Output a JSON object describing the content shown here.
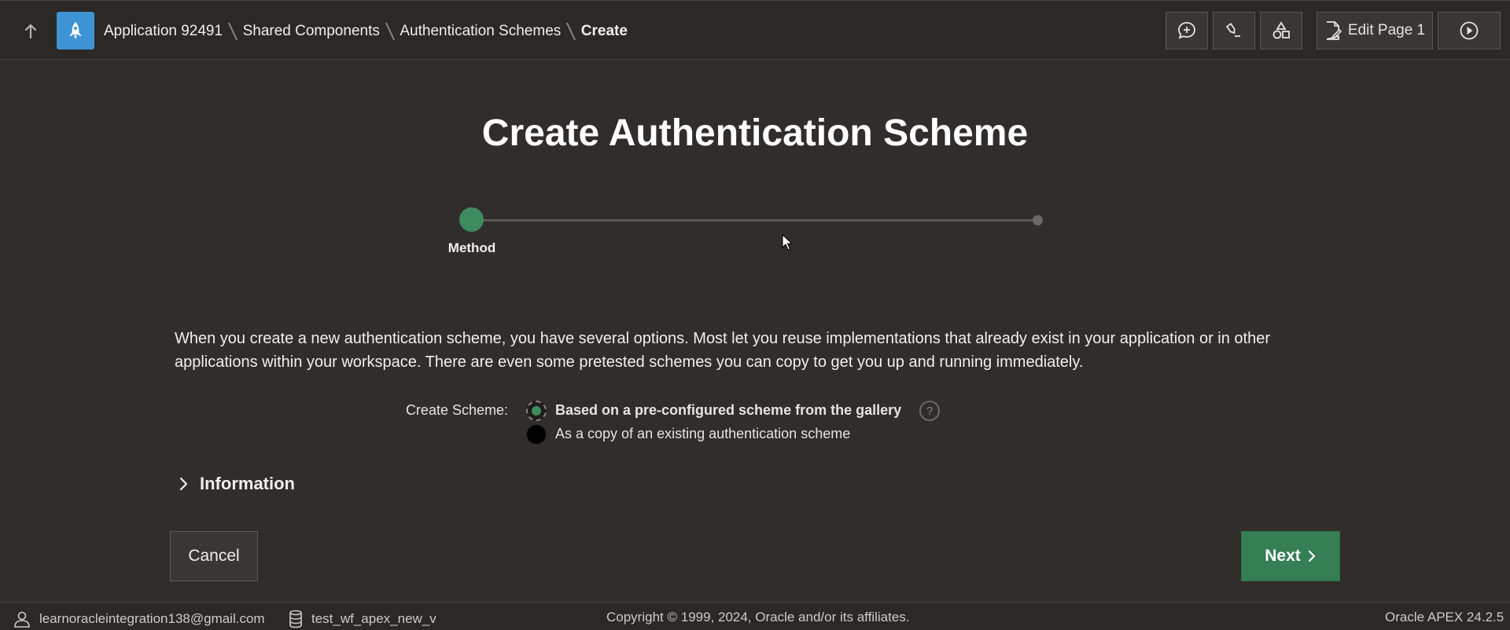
{
  "header": {
    "breadcrumb": [
      {
        "label": "Application 92491"
      },
      {
        "label": "Shared Components"
      },
      {
        "label": "Authentication Schemes"
      },
      {
        "label": "Create"
      }
    ],
    "tools": {
      "edit_page_label": "Edit Page 1"
    }
  },
  "main": {
    "title": "Create Authentication Scheme",
    "wizard": {
      "steps": [
        {
          "label": "Method",
          "active": true
        }
      ]
    },
    "description": "When you create a new authentication scheme, you have several options. Most let you reuse implementations that already exist in your application or in other applications within your workspace. There are even some pretested schemes you can copy to get you up and running immediately.",
    "create_scheme": {
      "label": "Create Scheme:",
      "options": [
        {
          "label": "Based on a pre-configured scheme from the gallery",
          "selected": true
        },
        {
          "label": "As a copy of an existing authentication scheme",
          "selected": false
        }
      ],
      "help": "?"
    },
    "information": {
      "title": "Information"
    },
    "buttons": {
      "cancel": "Cancel",
      "next": "Next"
    }
  },
  "footer": {
    "user": "learnoracleintegration138@gmail.com",
    "schema": "test_wf_apex_new_v",
    "copyright": "Copyright © 1999, 2024, Oracle and/or its affiliates.",
    "version": "Oracle APEX 24.2.5"
  },
  "colors": {
    "background": "#312d2a",
    "accent_green": "#367e54",
    "app_icon_blue": "#3e93d5"
  }
}
